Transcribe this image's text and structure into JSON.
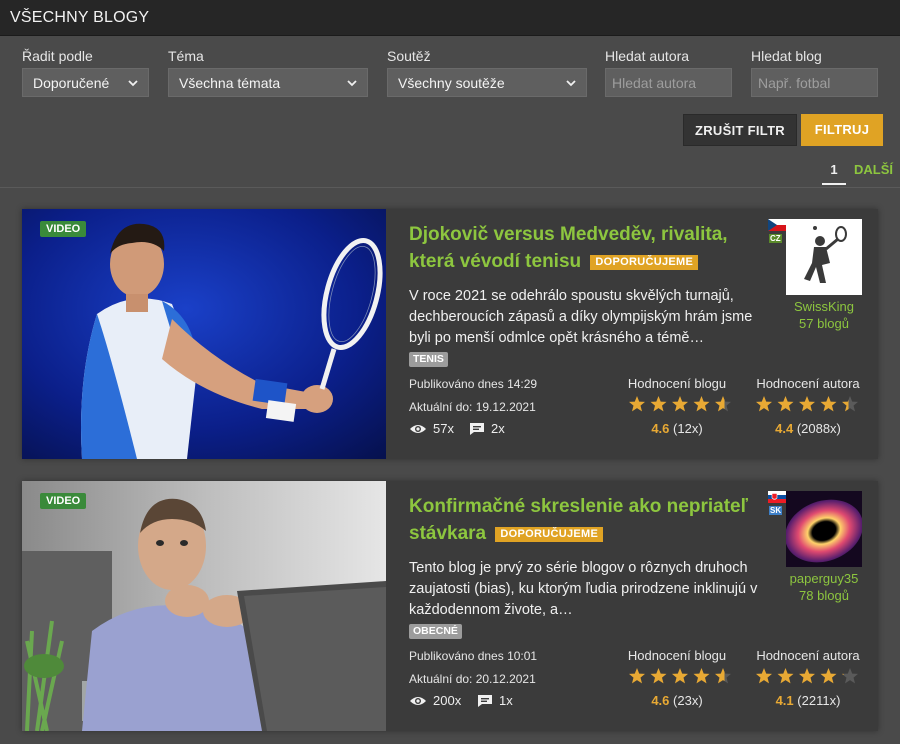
{
  "header": {
    "title": "VŠECHNY BLOGY"
  },
  "filters": {
    "sort": {
      "label": "Řadit podle",
      "value": "Doporučené"
    },
    "topic": {
      "label": "Téma",
      "value": "Všechna témata"
    },
    "competition": {
      "label": "Soutěž",
      "value": "Všechny soutěže"
    },
    "author": {
      "label": "Hledat autora",
      "placeholder": "Hledat autora"
    },
    "blog": {
      "label": "Hledat blog",
      "placeholder": "Např. fotbal"
    },
    "clear_label": "ZRUŠIT FILTR",
    "filter_label": "FILTRUJ"
  },
  "pagination": {
    "current": "1",
    "next": "DALŠÍ"
  },
  "blogs": [
    {
      "badge": "VIDEO",
      "title": "Djokovič versus Medveděv, rivalita, která vévodí tenisu",
      "recommended": "DOPORUČUJEME",
      "excerpt": "V roce 2021 se odehrálo spoustu skvělých turnajů, dechberoucích zápasů a díky olympijským hrám jsme byli po menší odmlce opět krásného a témě…",
      "tag": "TENIS",
      "published": "Publikováno dnes 14:29",
      "valid": "Aktuální do: 19.12.2021",
      "views": "57x",
      "comments": "2x",
      "blog_rating_label": "Hodnocení blogu",
      "blog_rating": "4.6",
      "blog_rating_count": "(12x)",
      "blog_rating_stars": 4.6,
      "author_rating_label": "Hodnocení autora",
      "author_rating": "4.4",
      "author_rating_count": "(2088x)",
      "author_rating_stars": 4.4,
      "flag_code": "CZ",
      "author_name": "SwissKing",
      "author_blogs": "57 blogů"
    },
    {
      "badge": "VIDEO",
      "title": "Konfirmačné skreslenie ako nepriateľ stávkara",
      "recommended": "DOPORUČUJEME",
      "excerpt": "Tento blog je prvý zo série blogov o rôznych druhoch zaujatosti (bias), ku ktorým ľudia prirodzene inklinujú v každodennom živote, a…",
      "tag": "OBECNÉ",
      "published": "Publikováno dnes 10:01",
      "valid": "Aktuální do: 20.12.2021",
      "views": "200x",
      "comments": "1x",
      "blog_rating_label": "Hodnocení blogu",
      "blog_rating": "4.6",
      "blog_rating_count": "(23x)",
      "blog_rating_stars": 4.6,
      "author_rating_label": "Hodnocení autora",
      "author_rating": "4.1",
      "author_rating_count": "(2211x)",
      "author_rating_stars": 4.1,
      "flag_code": "SK",
      "author_name": "paperguy35",
      "author_blogs": "78 blogů"
    }
  ],
  "colors": {
    "accent_green": "#8dc63f",
    "accent_orange": "#e0a324",
    "star": "#e8a934"
  }
}
